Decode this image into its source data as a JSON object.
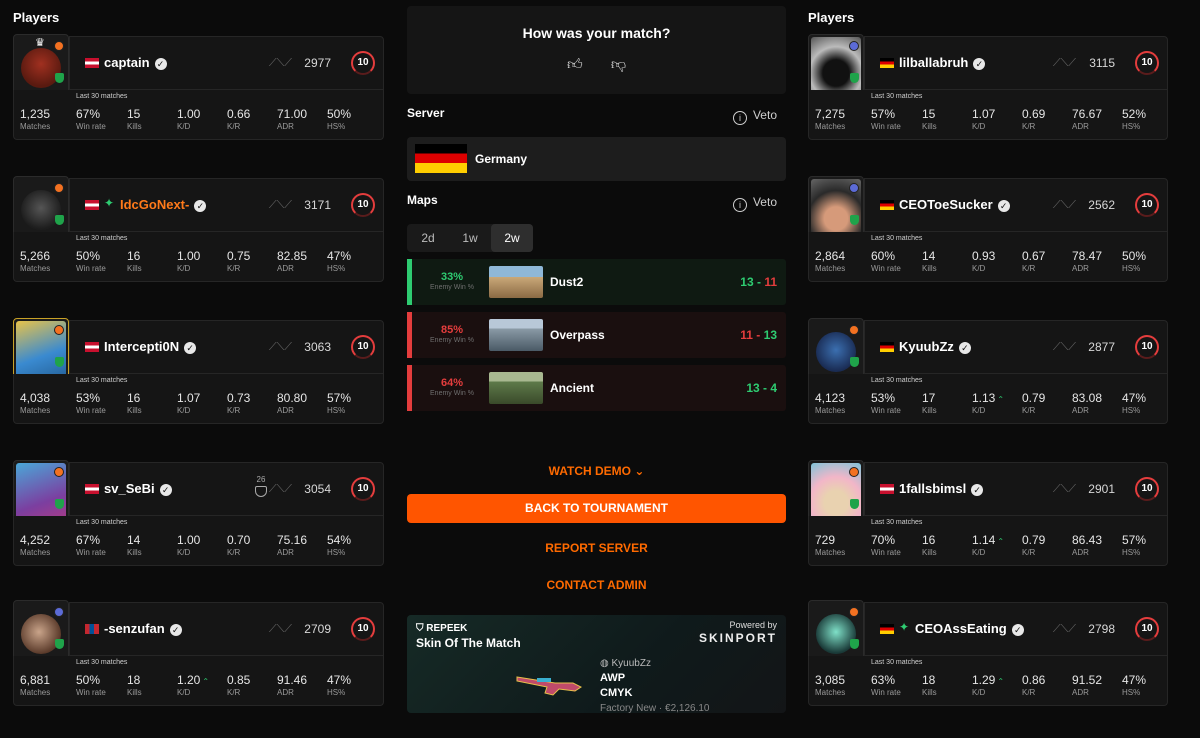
{
  "left_title": "Players",
  "right_title": "Players",
  "stat_labels": {
    "matches": "Matches",
    "winrate": "Win rate",
    "kills": "Kills",
    "kd": "K/D",
    "kr": "K/R",
    "adr": "ADR",
    "hs": "HS%"
  },
  "last30_label": "Last 30 matches",
  "left_players": [
    {
      "name": "captain",
      "flag": "AT",
      "elo": "2977",
      "level": "10",
      "matches": "1,235",
      "winrate": "67%",
      "kills": "15",
      "kd": "1.00",
      "kr": "0.66",
      "adr": "71.00",
      "hs": "50%"
    },
    {
      "name": "IdcGoNext-",
      "flag": "AT",
      "elo": "3171",
      "level": "10",
      "matches": "5,266",
      "winrate": "50%",
      "kills": "16",
      "kd": "1.00",
      "kr": "0.75",
      "adr": "82.85",
      "hs": "47%"
    },
    {
      "name": "Intercepti0N",
      "flag": "AT",
      "elo": "3063",
      "level": "10",
      "matches": "4,038",
      "winrate": "53%",
      "kills": "16",
      "kd": "1.07",
      "kr": "0.73",
      "adr": "80.80",
      "hs": "57%"
    },
    {
      "name": "sv_SeBi",
      "flag": "AT",
      "elo": "3054",
      "level": "10",
      "badge": "26",
      "matches": "4,252",
      "winrate": "67%",
      "kills": "14",
      "kd": "1.00",
      "kr": "0.70",
      "adr": "75.16",
      "hs": "54%"
    },
    {
      "name": "-senzufan",
      "flag": "MN",
      "elo": "2709",
      "level": "10",
      "matches": "6,881",
      "winrate": "50%",
      "kills": "18",
      "kd": "1.20",
      "kr": "0.85",
      "adr": "91.46",
      "hs": "47%"
    }
  ],
  "right_players": [
    {
      "name": "lilballabruh",
      "flag": "DE",
      "elo": "3115",
      "level": "10",
      "matches": "7,275",
      "winrate": "57%",
      "kills": "15",
      "kd": "1.07",
      "kr": "0.69",
      "adr": "76.67",
      "hs": "52%"
    },
    {
      "name": "CEOToeSucker",
      "flag": "DE",
      "elo": "2562",
      "level": "10",
      "matches": "2,864",
      "winrate": "60%",
      "kills": "14",
      "kd": "0.93",
      "kr": "0.67",
      "adr": "78.47",
      "hs": "50%"
    },
    {
      "name": "KyuubZz",
      "flag": "DE",
      "elo": "2877",
      "level": "10",
      "matches": "4,123",
      "winrate": "53%",
      "kills": "17",
      "kd": "1.13",
      "kr": "0.79",
      "adr": "83.08",
      "hs": "47%"
    },
    {
      "name": "1fallsbimsl",
      "flag": "AT",
      "elo": "2901",
      "level": "10",
      "matches": "729",
      "winrate": "70%",
      "kills": "16",
      "kd": "1.14",
      "kr": "0.79",
      "adr": "86.43",
      "hs": "57%"
    },
    {
      "name": "CEOAssEating",
      "flag": "DE",
      "elo": "2798",
      "level": "10",
      "matches": "3,085",
      "winrate": "63%",
      "kills": "18",
      "kd": "1.29",
      "kr": "0.86",
      "adr": "91.52",
      "hs": "47%"
    }
  ],
  "rating": {
    "question": "How was your match?"
  },
  "server": {
    "title": "Server",
    "veto": "Veto",
    "name": "Germany"
  },
  "maps": {
    "title": "Maps",
    "veto": "Veto",
    "tabs": [
      "2d",
      "1w",
      "2w"
    ],
    "enemy_label": "Enemy Win %",
    "rows": [
      {
        "pct": "33%",
        "name": "Dust2",
        "score": "13 - 11"
      },
      {
        "pct": "85%",
        "name": "Overpass",
        "score": "11 - 13"
      },
      {
        "pct": "64%",
        "name": "Ancient",
        "score": "13 - 4"
      }
    ]
  },
  "actions": {
    "watch_demo": "WATCH DEMO",
    "back": "BACK TO TOURNAMENT",
    "report": "REPORT SERVER",
    "contact": "CONTACT ADMIN"
  },
  "skin": {
    "brand": "REPEEK",
    "title": "Skin Of The Match",
    "powered_by": "Powered by",
    "sponsor": "SKINPORT",
    "owner": "KyuubZz",
    "weapon": "AWP",
    "skin_name": "CMYK",
    "condition": "Factory New · €2,126.10"
  },
  "colors": {
    "accent": "#ff5500",
    "win": "#2ecc71",
    "loss": "#e43d3d",
    "card": "#151515"
  }
}
